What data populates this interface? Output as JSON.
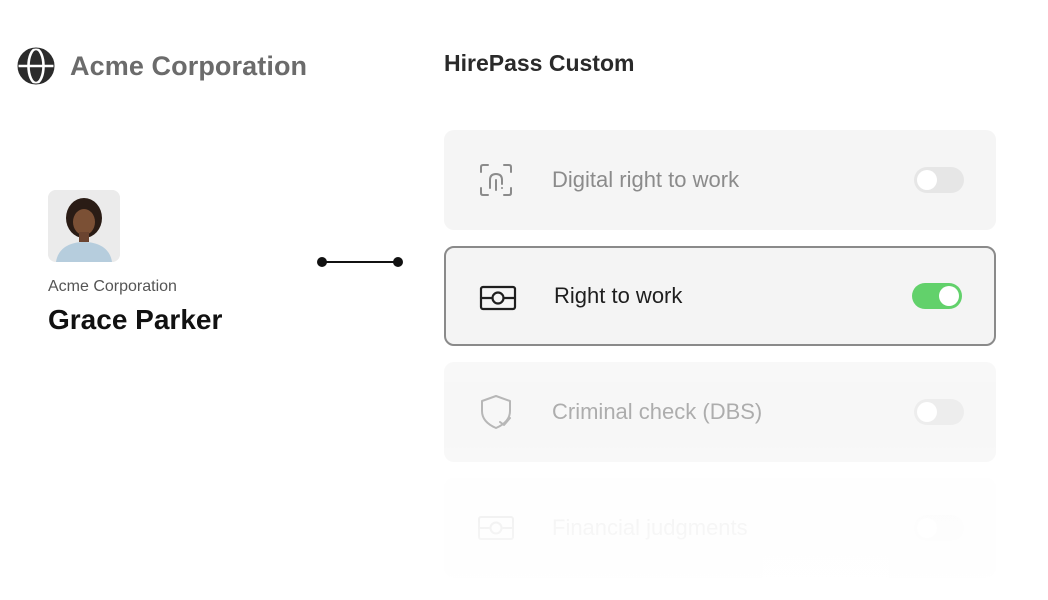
{
  "brand": {
    "name": "Acme Corporation",
    "icon": "globe-icon"
  },
  "candidate": {
    "organization": "Acme Corporation",
    "name": "Grace Parker"
  },
  "product": {
    "title": "HirePass Custom"
  },
  "checks": [
    {
      "label": "Digital right to work",
      "icon": "fingerprint-scan-icon",
      "enabled": false
    },
    {
      "label": "Right to work",
      "icon": "id-card-icon",
      "enabled": true
    },
    {
      "label": "Criminal check (DBS)",
      "icon": "shield-check-icon",
      "enabled": false
    },
    {
      "label": "Financial judgments",
      "icon": "card-icon",
      "enabled": false
    }
  ],
  "colors": {
    "toggle_on": "#62d16b",
    "toggle_off": "#e6e6e6",
    "brand_text": "#6b6b6b"
  }
}
